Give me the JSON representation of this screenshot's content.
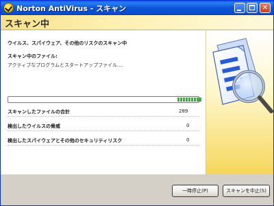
{
  "window": {
    "title": "Norton AntiVirus - スキャン",
    "minimize_label": "_",
    "maximize_label": "□",
    "close_label": "✕"
  },
  "header": {
    "title": "スキャン中"
  },
  "main": {
    "section_title": "ウイルス、スパイウェア、その他のリスクのスキャン中",
    "scanning_label": "スキャン中のファイル:",
    "scanning_value": "アクティブなプログラムとスタートアップファイル....",
    "progress_segments": 9,
    "stats": [
      {
        "label": "スキャンしたファイルの合計",
        "value": "289"
      },
      {
        "label": "検出したウイルスの脅威",
        "value": "0"
      },
      {
        "label": "検出したスパイウェアとその他のセキュリティリスク",
        "value": "0"
      }
    ]
  },
  "buttons": {
    "pause": "一時停止(P)",
    "stop": "スキャンを中止(S)"
  },
  "icons": {
    "title": "norton-check-icon",
    "side": "document-magnifier-icon"
  },
  "colors": {
    "titlebar": "#0a5ddd",
    "progress_fill": "#2ebd2e",
    "header_band": "#f7e08a"
  }
}
